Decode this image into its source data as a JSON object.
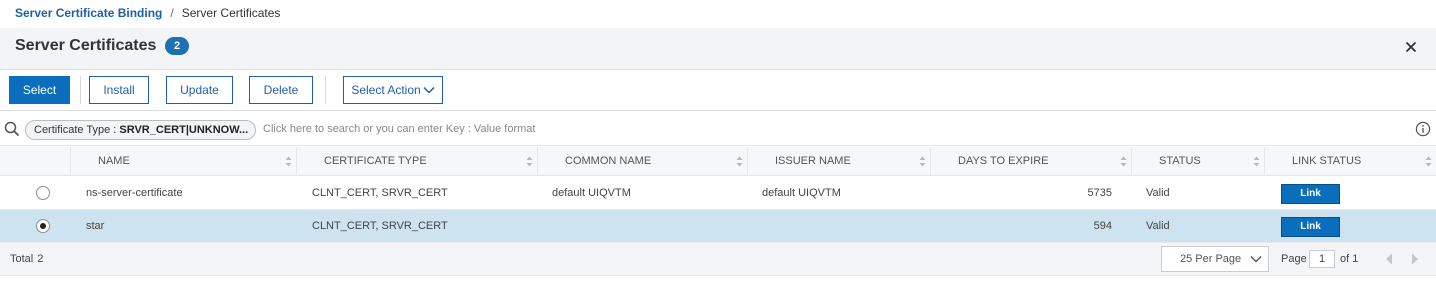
{
  "breadcrumb": {
    "parent": "Server Certificate Binding",
    "separator": "/",
    "current": "Server Certificates"
  },
  "header": {
    "title": "Server Certificates",
    "count": "2"
  },
  "toolbar": {
    "select": "Select",
    "install": "Install",
    "update": "Update",
    "delete": "Delete",
    "select_action": "Select Action"
  },
  "search": {
    "chip_key": "Certificate Type : ",
    "chip_value": "SRVR_CERT|UNKNOW...",
    "placeholder": "Click here to search or you can enter Key : Value format"
  },
  "table": {
    "columns": [
      "NAME",
      "CERTIFICATE TYPE",
      "COMMON NAME",
      "ISSUER NAME",
      "DAYS TO EXPIRE",
      "STATUS",
      "LINK STATUS"
    ],
    "rows": [
      {
        "selected": false,
        "name": "ns-server-certificate",
        "certificate_type": "CLNT_CERT, SRVR_CERT",
        "common_name": "default UIQVTM",
        "issuer_name": "default UIQVTM",
        "days_to_expire": "5735",
        "status": "Valid",
        "link_status": "Link"
      },
      {
        "selected": true,
        "name": "star",
        "certificate_type": "CLNT_CERT, SRVR_CERT",
        "common_name": "",
        "issuer_name": "",
        "days_to_expire": "594",
        "status": "Valid",
        "link_status": "Link"
      }
    ]
  },
  "footer": {
    "total_label": "Total",
    "total_count": "2",
    "per_page": "25 Per Page",
    "page_label": "Page",
    "page_value": "1",
    "of_label": "of 1"
  },
  "colors": {
    "accent": "#0a6ebd",
    "link_text": "#1f5fa8",
    "selected_row": "#cde3ef"
  },
  "icons": [
    "search-icon",
    "close-icon",
    "info-icon",
    "chevron-down-icon",
    "sort-icon",
    "chevron-left-icon",
    "chevron-right-icon"
  ]
}
